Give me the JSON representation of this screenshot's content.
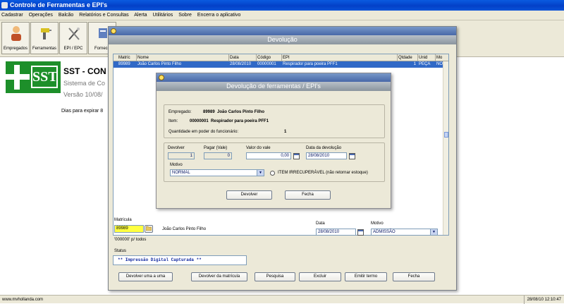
{
  "app": {
    "title": "Controle de Ferramentas e EPI's",
    "menu": [
      "Cadastrar",
      "Operações",
      "Balcão",
      "Relatórios e Consultas",
      "Alerta",
      "Utilitários",
      "Sobre",
      "Encerra o aplicativo"
    ],
    "toolbar": [
      {
        "label": "Empregados",
        "icon": "person-icon"
      },
      {
        "label": "Ferramentas",
        "icon": "drill-icon"
      },
      {
        "label": "EPI / EPC",
        "icon": "tools-icon"
      },
      {
        "label": "Fornece",
        "icon": "supplier-icon"
      }
    ],
    "logo_text": "SST",
    "bg_title": "SST - CON",
    "bg_subtitle": "Sistema de Co",
    "bg_version": "Versão 10/08/",
    "days_to_expire": "Dias para expirar 8",
    "status_url": "www.mvhollanda.com",
    "status_datetime": "28/08/10 12:10:47"
  },
  "devolucao": {
    "caption": "Devolução",
    "columns": [
      "Matríc",
      "Nome",
      "Data",
      "Código",
      "EPI",
      "Qtdade",
      "Unid",
      "Mo"
    ],
    "rows": [
      {
        "matric": "89989",
        "nome": "João Carlos Pinto Filho",
        "data": "28/08/2010",
        "codigo": "00000001",
        "epi": "Respirador para poeira PFF1",
        "qtdade": "1",
        "unid": "PEÇA",
        "mo": "NO"
      }
    ],
    "matricula_label": "Matrícula",
    "matricula_value": "89989",
    "employee_name": "João Carlos Pinto Filho",
    "hint": "'000000' p/ todos",
    "data_label": "Data",
    "data_value": "28/08/2010",
    "motivo_label": "Motivo",
    "motivo_value": "ADMISSÃO",
    "status_label": "Status",
    "status_value": "** Impressão Digital Capturada **",
    "buttons": {
      "devolver_uma": "Devolver uma a uma",
      "devolver_matricula": "Devolver da matrícula",
      "pesquisa": "Pesquisa",
      "excluir": "Excluir",
      "emitir_termo": "Emitir termo",
      "fecha": "Fecha"
    }
  },
  "dialog": {
    "caption": "Devolução de ferramentas / EPI's",
    "empregado_label": "Empregado:",
    "empregado_value": "89989  João Carlos Pinto Filho",
    "item_label": "Item:",
    "item_value": "00000001  Respirador para poeira PFF1",
    "qtd_label": "Quantidade em poder do funcionário:",
    "qtd_value": "1",
    "devolver_label": "Devolver",
    "devolver_value": "1",
    "pagar_label": "Pagar (Vale)",
    "pagar_value": "0",
    "valor_label": "Valor do vale",
    "valor_value": "0,00",
    "data_label": "Data da devolução",
    "data_value": "28/08/2010",
    "motivo_label": "Motivo",
    "motivo_value": "NORMAL",
    "irrecuperavel_label": "ITEM IRRECUPERÁVEL (não retornar estoque)",
    "btn_devolver": "Devolver",
    "btn_fecha": "Fecha"
  },
  "colors": {
    "title_blue": "#0a54d8",
    "selection": "#3169c6",
    "logo_green": "#1d8f2a"
  }
}
